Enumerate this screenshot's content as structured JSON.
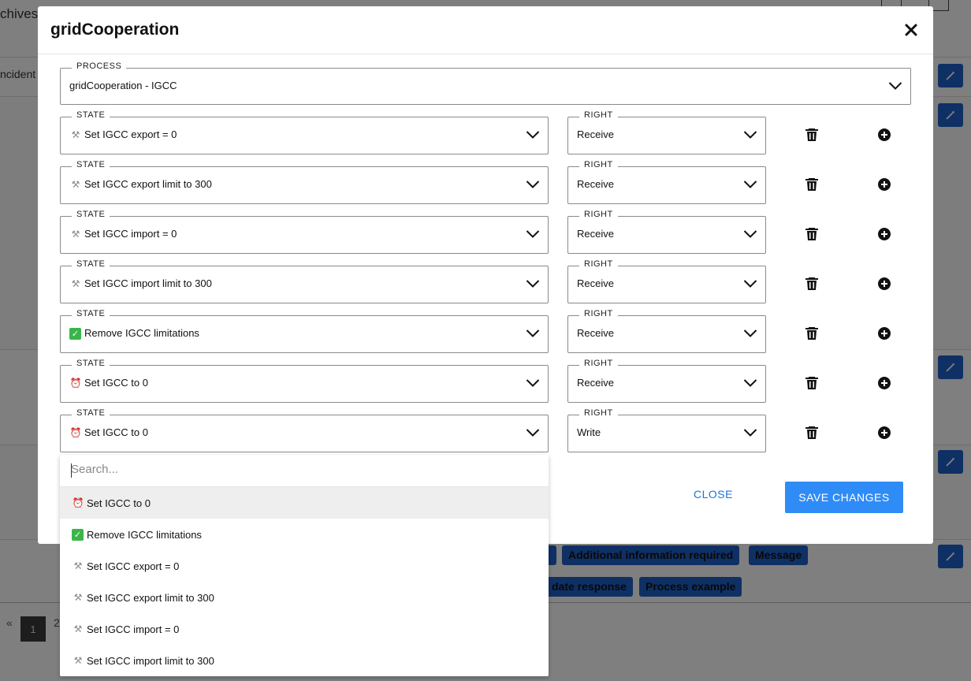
{
  "background": {
    "archives_label": "chives",
    "incident_label": "ncident",
    "tags_row1": [
      "Additional information required",
      "Message"
    ],
    "tags_row2": [
      "date response",
      "Process example"
    ],
    "pagination": {
      "prev": "«",
      "current": "1",
      "next_page": "2"
    }
  },
  "modal": {
    "title": "gridCooperation",
    "process": {
      "legend": "PROCESS",
      "value": "gridCooperation - IGCC"
    },
    "state_legend": "STATE",
    "right_legend": "RIGHT",
    "rows": [
      {
        "state_icon": "wrench",
        "state": "Set IGCC export = 0",
        "right": "Receive"
      },
      {
        "state_icon": "wrench",
        "state": "Set IGCC export limit to 300",
        "right": "Receive"
      },
      {
        "state_icon": "wrench",
        "state": "Set IGCC import = 0",
        "right": "Receive"
      },
      {
        "state_icon": "wrench",
        "state": "Set IGCC import limit to 300",
        "right": "Receive"
      },
      {
        "state_icon": "check",
        "state": "Remove IGCC limitations",
        "right": "Receive"
      },
      {
        "state_icon": "alarm",
        "state": "Set IGCC to 0",
        "right": "Receive"
      },
      {
        "state_icon": "alarm",
        "state": "Set IGCC to 0",
        "right": "Write"
      }
    ],
    "close_label": "CLOSE",
    "save_label": "SAVE CHANGES"
  },
  "dropdown": {
    "placeholder": "Search...",
    "options": [
      {
        "icon": "alarm",
        "label": "Set IGCC to 0",
        "selected": true
      },
      {
        "icon": "check",
        "label": "Remove IGCC limitations",
        "selected": false
      },
      {
        "icon": "wrench",
        "label": "Set IGCC export = 0",
        "selected": false
      },
      {
        "icon": "wrench",
        "label": "Set IGCC export limit to 300",
        "selected": false
      },
      {
        "icon": "wrench",
        "label": "Set IGCC import = 0",
        "selected": false
      },
      {
        "icon": "wrench",
        "label": "Set IGCC import limit to 300",
        "selected": false
      }
    ]
  },
  "colors": {
    "primary": "#2f8cf7",
    "link": "#1e74d8",
    "tag": "#1e60c8",
    "overlay": "rgba(0,0,0,0.5)"
  }
}
